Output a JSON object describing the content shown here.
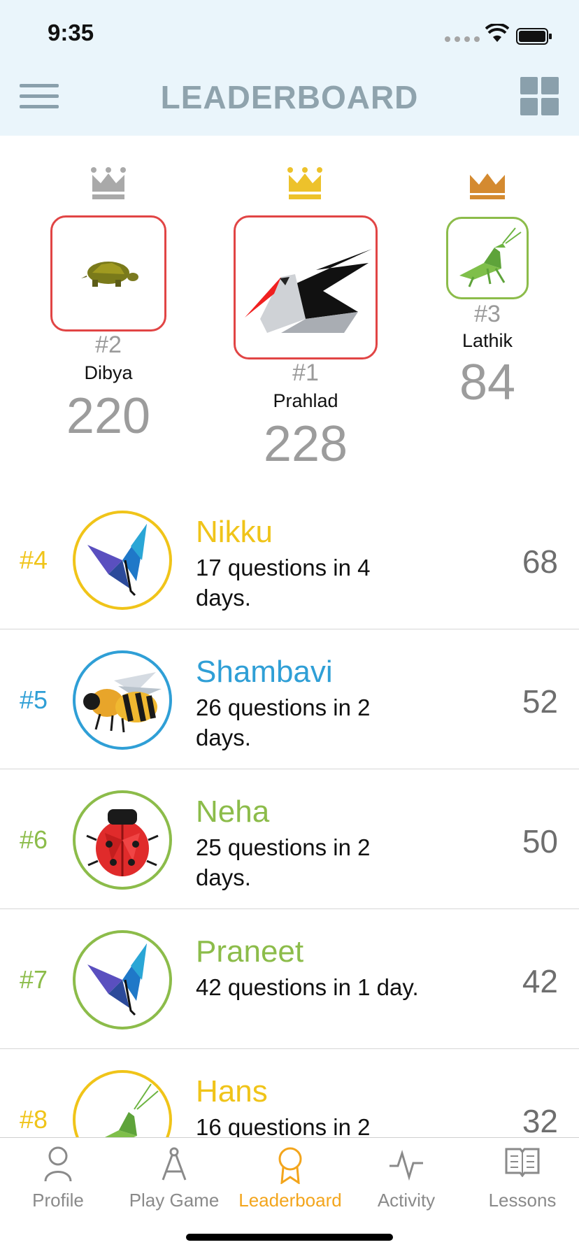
{
  "status": {
    "time": "9:35"
  },
  "header": {
    "title": "LEADERBOARD",
    "menu_icon": "hamburger-menu-icon",
    "grid_icon": "grid-view-icon"
  },
  "podium": [
    {
      "rank": "#2",
      "name": "Dibya",
      "score": "220",
      "crown_color": "#a9a9a9",
      "border_color": "#e14545",
      "avatar": "turtle"
    },
    {
      "rank": "#1",
      "name": "Prahlad",
      "score": "228",
      "crown_color": "#edc22b",
      "border_color": "#e14545",
      "avatar": "pelican"
    },
    {
      "rank": "#3",
      "name": "Lathik",
      "score": "84",
      "crown_color": "#d48a30",
      "border_color": "#8cbc4a",
      "avatar": "mantis"
    }
  ],
  "list": [
    {
      "rank": "#4",
      "name": "Nikku",
      "detail": "17 questions in 4 days.",
      "score": "68",
      "color": "#f0c419",
      "avatar": "butterfly"
    },
    {
      "rank": "#5",
      "name": "Shambavi",
      "detail": "26 questions in 2 days.",
      "score": "52",
      "color": "#2f9fd6",
      "avatar": "bee"
    },
    {
      "rank": "#6",
      "name": "Neha",
      "detail": "25 questions in 2 days.",
      "score": "50",
      "color": "#8cbc4a",
      "avatar": "ladybug"
    },
    {
      "rank": "#7",
      "name": "Praneet",
      "detail": "42 questions in 1 day.",
      "score": "42",
      "color": "#8cbc4a",
      "avatar": "butterfly"
    },
    {
      "rank": "#8",
      "name": "Hans",
      "detail": "16 questions in 2",
      "score": "32",
      "color": "#f0c419",
      "avatar": "mantis"
    }
  ],
  "tabs": [
    {
      "label": "Profile",
      "icon": "person-icon"
    },
    {
      "label": "Play Game",
      "icon": "compass-icon"
    },
    {
      "label": "Leaderboard",
      "icon": "award-ribbon-icon",
      "active": true
    },
    {
      "label": "Activity",
      "icon": "activity-pulse-icon"
    },
    {
      "label": "Lessons",
      "icon": "open-book-icon"
    }
  ],
  "colors": {
    "header_bg": "#eaf5fb",
    "active_tab": "#f3a51c",
    "inactive_tab": "#8a8a8a"
  }
}
